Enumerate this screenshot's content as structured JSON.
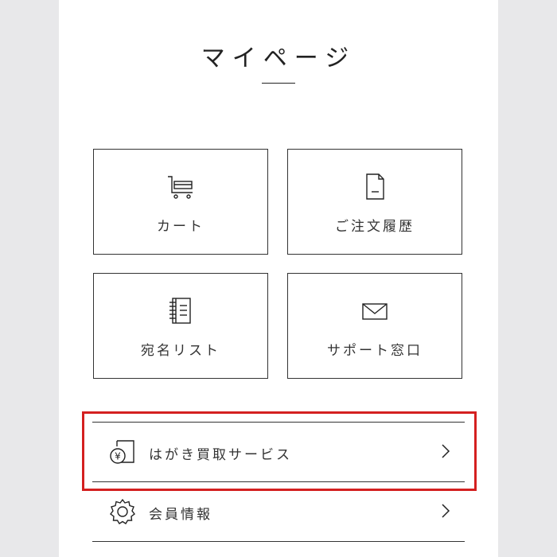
{
  "header": {
    "title": "マイページ"
  },
  "tiles": [
    {
      "label": "カート",
      "icon": "cart-icon"
    },
    {
      "label": "ご注文履歴",
      "icon": "document-icon"
    },
    {
      "label": "宛名リスト",
      "icon": "notebook-icon"
    },
    {
      "label": "サポート窓口",
      "icon": "envelope-icon"
    }
  ],
  "menu": [
    {
      "label": "はがき買取サービス",
      "icon": "yen-card-icon",
      "highlighted": true
    },
    {
      "label": "会員情報",
      "icon": "gear-icon",
      "highlighted": false
    }
  ],
  "colors": {
    "highlight": "#d42020",
    "background": "#e8e8ea",
    "panel": "#ffffff"
  }
}
